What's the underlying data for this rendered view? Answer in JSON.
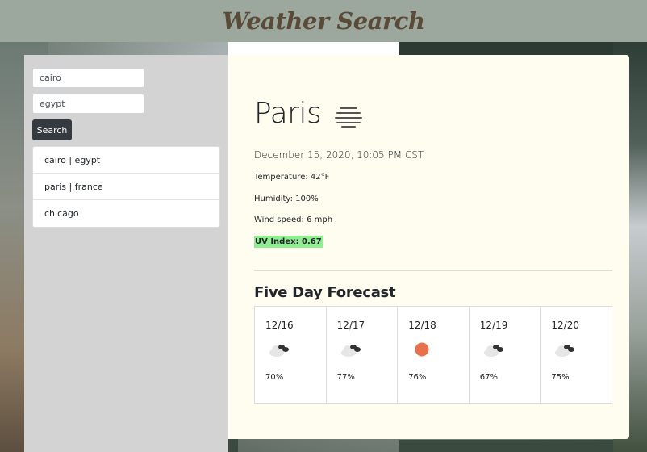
{
  "header": {
    "title": "Weather Search"
  },
  "search": {
    "city_value": "cairo",
    "country_value": "egypt",
    "button_label": "Search"
  },
  "history": [
    {
      "label": "cairo | egypt"
    },
    {
      "label": "paris | france"
    },
    {
      "label": "chicago"
    }
  ],
  "current": {
    "city": "Paris",
    "icon": "mist-icon",
    "datetime": "December 15, 2020, 10:05 PM CST",
    "temperature": "Temperature: 42°F",
    "humidity": "Humidity: 100%",
    "wind": "Wind speed: 6 mph",
    "uv": "UV Index: 0.67",
    "uv_color": "#90ee90"
  },
  "forecast": {
    "title": "Five Day Forecast",
    "days": [
      {
        "date": "12/16",
        "icon": "partly-cloudy-icon",
        "humidity": "70%"
      },
      {
        "date": "12/17",
        "icon": "partly-cloudy-icon",
        "humidity": "77%"
      },
      {
        "date": "12/18",
        "icon": "sun-icon",
        "humidity": "76%"
      },
      {
        "date": "12/19",
        "icon": "partly-cloudy-icon",
        "humidity": "67%"
      },
      {
        "date": "12/20",
        "icon": "partly-cloudy-icon",
        "humidity": "75%"
      }
    ]
  },
  "colors": {
    "header_bg": "#9ca89e",
    "title_color": "#5a4a38",
    "sidebar_bg": "#d3d3d3",
    "main_bg": "#fefdf0",
    "button_bg": "#343a40",
    "sun_color": "#e8704d"
  }
}
